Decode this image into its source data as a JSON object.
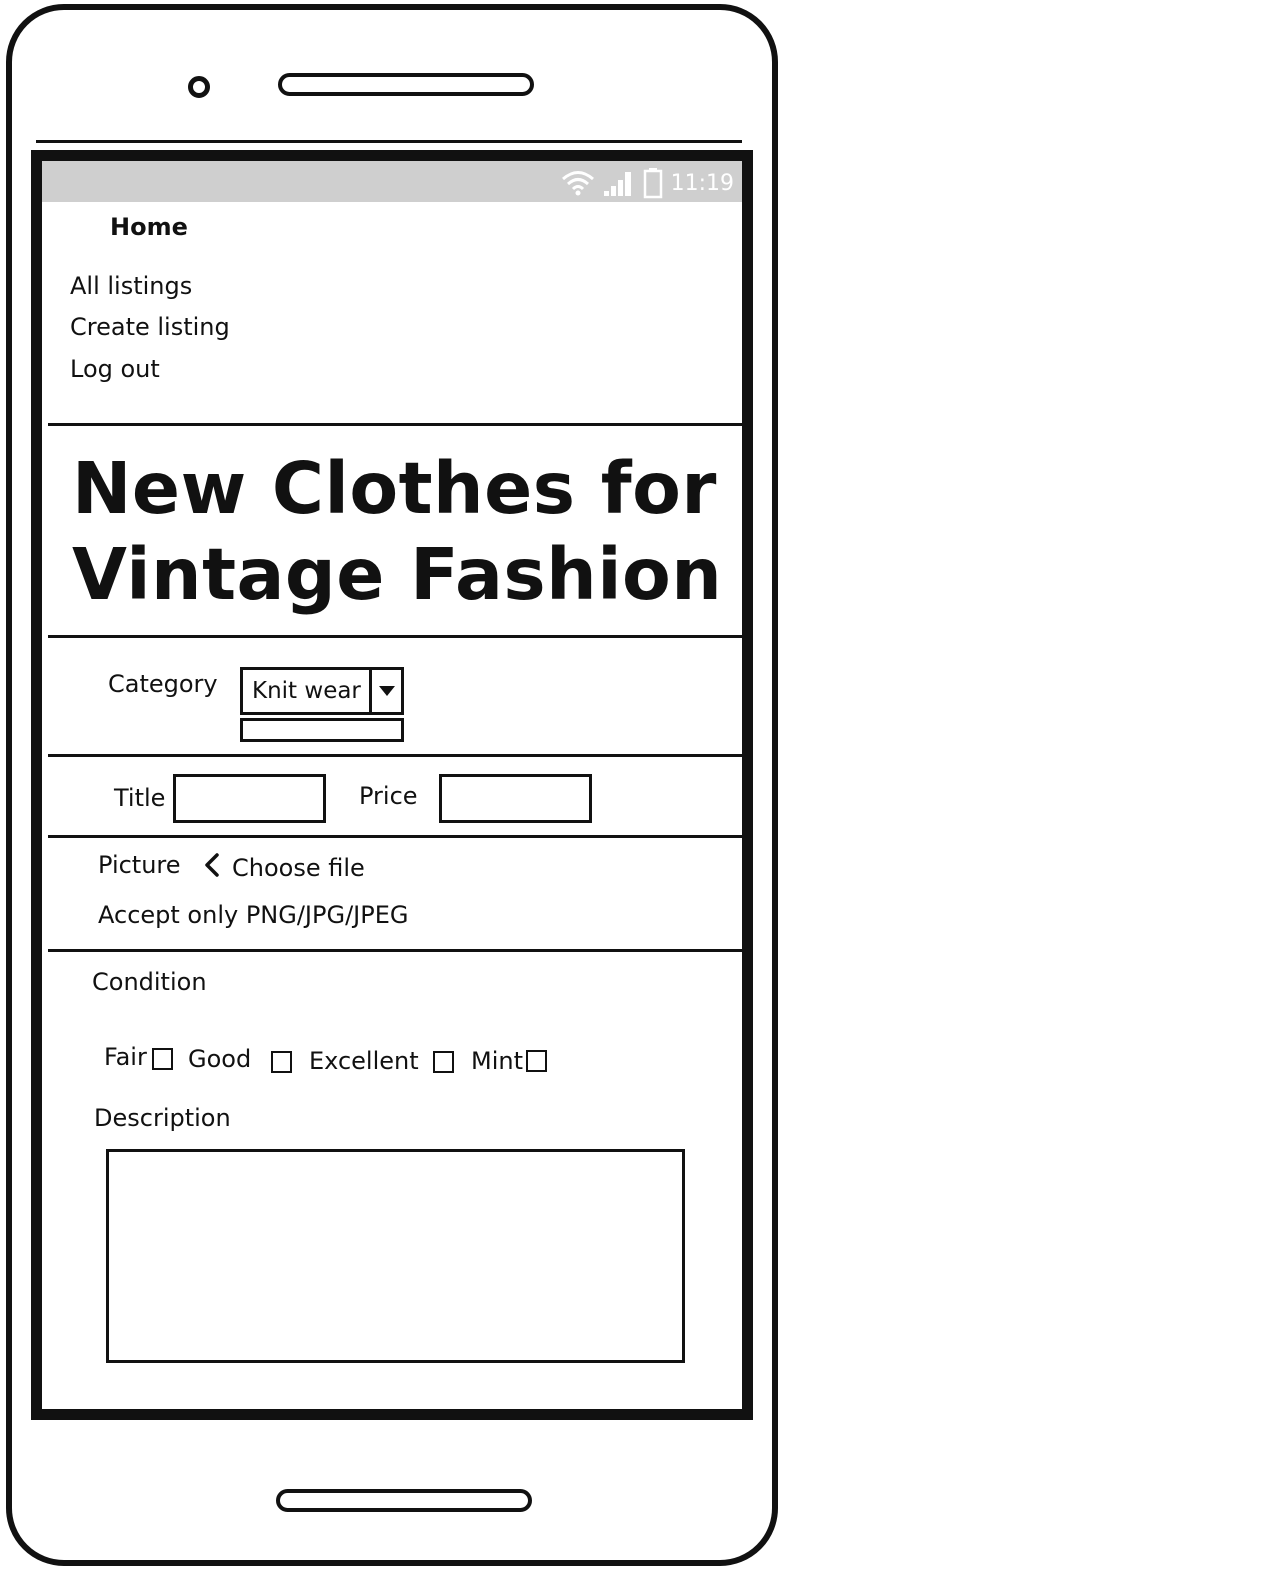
{
  "status_bar": {
    "time": "11:19",
    "icons": [
      "wifi-icon",
      "signal-icon",
      "battery-icon"
    ]
  },
  "nav": {
    "home": "Home",
    "items": [
      "All listings",
      "Create listing",
      "Log out"
    ]
  },
  "page": {
    "heading_line1": "New Clothes for",
    "heading_line2": "Vintage Fashion"
  },
  "form": {
    "category_label": "Category",
    "category_value": "Knit wear",
    "title_label": "Title",
    "title_value": "",
    "price_label": "Price",
    "price_value": "",
    "picture_label": "Picture",
    "choose_file": "Choose file",
    "picture_hint": "Accept only PNG/JPG/JPEG",
    "condition_label": "Condition",
    "conditions": [
      "Fair",
      "Good",
      "Excellent",
      "Mint"
    ],
    "description_label": "Description",
    "description_value": ""
  },
  "colors": {
    "ink": "#111111",
    "status_bar": "#cfcfcf",
    "background": "#ffffff"
  }
}
